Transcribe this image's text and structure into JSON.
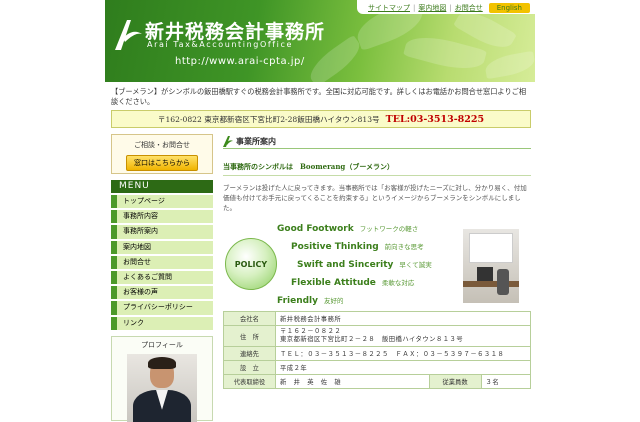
{
  "header": {
    "logo_jp": "新井税務会計事務所",
    "logo_en": "Arai Tax&AccountingOffice",
    "url": "http://www.arai-cpta.jp/",
    "links": [
      "サイトマップ",
      "案内地図",
      "お問合せ"
    ],
    "lang_button": "English"
  },
  "intro": "【ブーメラン】がシンボルの飯田橋駅すぐの税務会計事務所です。全国に対応可能です。詳しくはお電話かお問合せ窓口よりご相談ください。",
  "address_bar": {
    "address": "〒162-0822 東京都新宿区下宮比町2-28飯田橋ハイタウン813号",
    "tel": "TEL:03-3513-8225"
  },
  "sidebar": {
    "contact_title": "ご相談・お問合せ",
    "contact_button": "窓口はこちらから",
    "menu_title": "MENU",
    "menu_items": [
      "トップページ",
      "事務所内容",
      "事務所案内",
      "案内地図",
      "お問合せ",
      "よくあるご質問",
      "お客様の声",
      "プライバシーポリシー",
      "リンク"
    ],
    "profile_title": "プロフィール"
  },
  "main": {
    "section_title": "事業所案内",
    "symbol_line": "当事務所のシンボルは　Boomerang（ブーメラン）",
    "description": "ブーメランは投げた人に戻ってきます。当事務所では「お客様が投げたニーズに対し、分かり易く、付加価値も付けてお手元に戻ってくることを約束する」というイメージからブーメランをシンボルにしました。",
    "policy_label": "POLICY",
    "policies": [
      {
        "en": "Good Footwork",
        "jp": "フットワークの軽さ"
      },
      {
        "en": "Positive Thinking",
        "jp": "前向きな思考"
      },
      {
        "en": "Swift and Sincerity",
        "jp": "早くて誠実"
      },
      {
        "en": "Flexible Attitude",
        "jp": "柔軟な対応"
      },
      {
        "en": "Friendly",
        "jp": "友好的"
      }
    ]
  },
  "info_table": [
    {
      "label": "会社名",
      "value": "新井税務会計事務所"
    },
    {
      "label": "住　所",
      "value": "〒１６２－０８２２\n東京都新宿区下宮比町２－２８　飯田橋ハイタウン８１３号"
    },
    {
      "label": "連絡先",
      "value": "ＴＥＬ：０３－３５１３－８２２５　ＦＡＸ：０３－５３９７－６３１８"
    },
    {
      "label": "設　立",
      "value": "平成２年"
    },
    {
      "label": "代表取締役",
      "value": "新　井　英　佐　雄",
      "label2": "従業員数",
      "value2": "３名"
    }
  ]
}
